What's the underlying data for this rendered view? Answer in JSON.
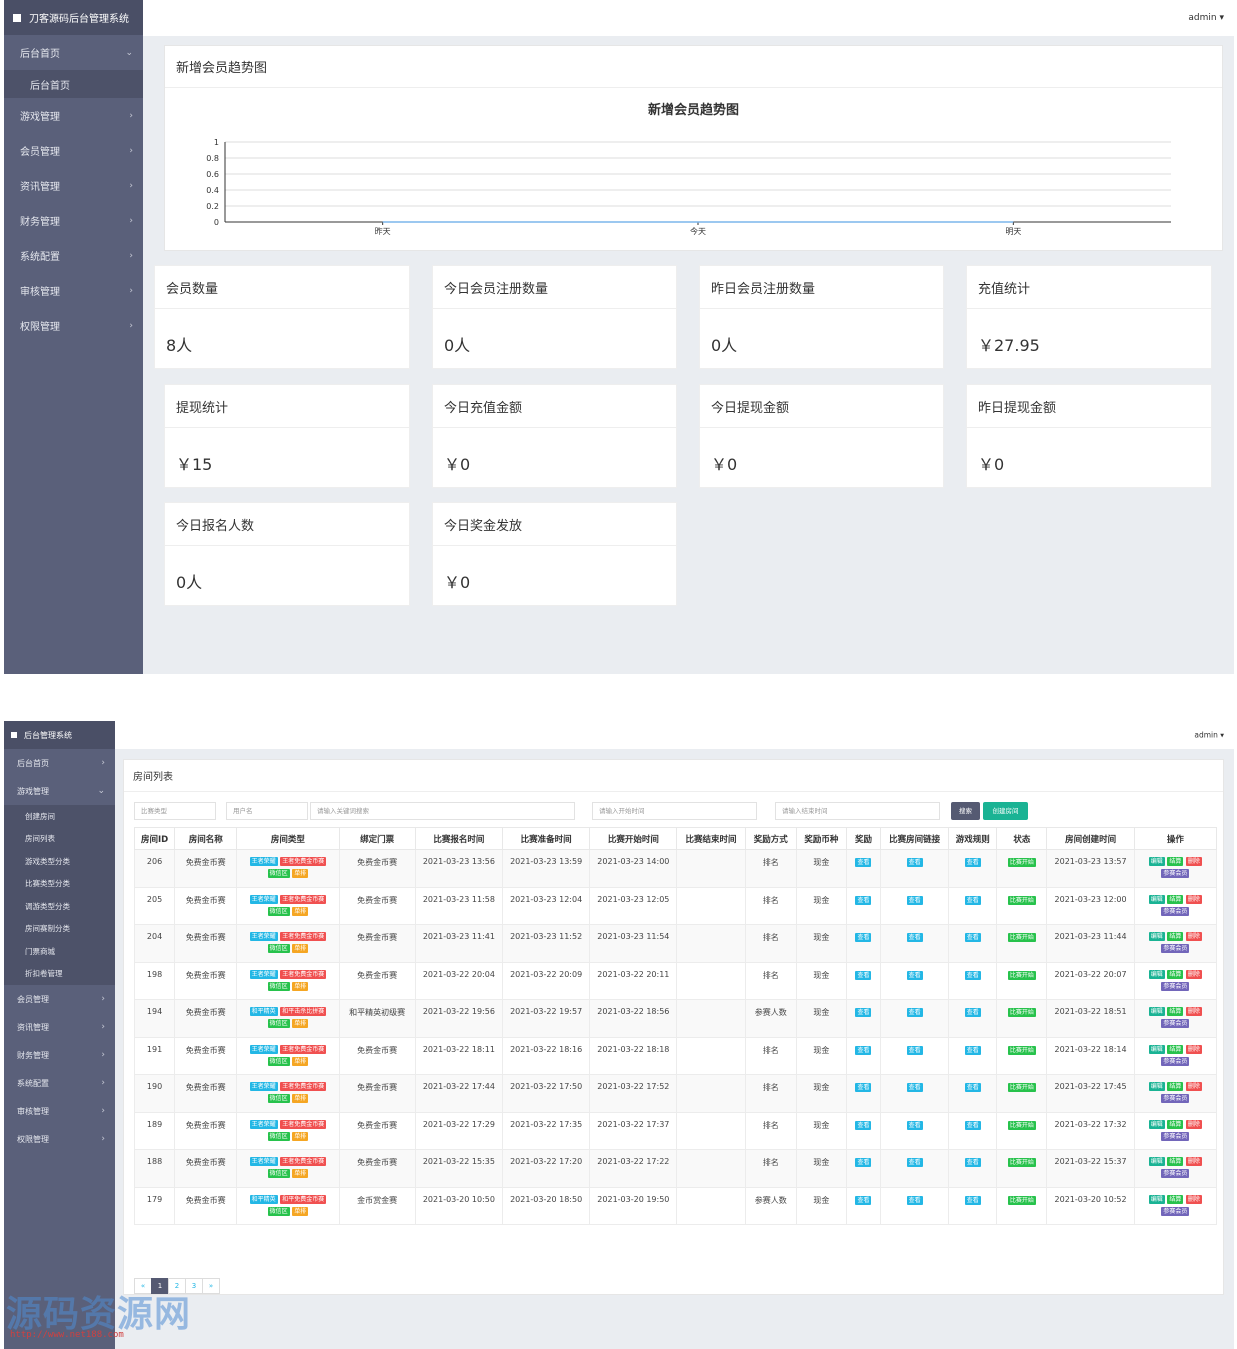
{
  "dashboard": {
    "brand": "刀客源码后台管理系统",
    "user": "admin",
    "nav": {
      "home": "后台首页",
      "home_sub": "后台首页",
      "items": [
        "游戏管理",
        "会员管理",
        "资讯管理",
        "财务管理",
        "系统配置",
        "审核管理",
        "权限管理"
      ]
    },
    "chart_panel_title": "新增会员趋势图",
    "chart_data": {
      "type": "line",
      "title": "新增会员趋势图",
      "categories": [
        "昨天",
        "今天",
        "明天"
      ],
      "series": [
        {
          "values": [
            0,
            0,
            0
          ]
        }
      ],
      "yticks": [
        "0",
        "0.2",
        "0.4",
        "0.6",
        "0.8",
        "1"
      ],
      "ylim": [
        0,
        1
      ],
      "grid": true
    },
    "stats": [
      {
        "label": "会员数量",
        "value": "8人"
      },
      {
        "label": "今日会员注册数量",
        "value": "0人"
      },
      {
        "label": "昨日会员注册数量",
        "value": "0人"
      },
      {
        "label": "充值统计",
        "value": "￥27.95"
      },
      {
        "label": "提现统计",
        "value": "￥15"
      },
      {
        "label": "今日充值金额",
        "value": "￥0"
      },
      {
        "label": "今日提现金额",
        "value": "￥0"
      },
      {
        "label": "昨日提现金额",
        "value": "￥0"
      },
      {
        "label": "今日报名人数",
        "value": "0人"
      },
      {
        "label": "今日奖金发放",
        "value": "￥0"
      }
    ]
  },
  "rooms_page": {
    "brand": "后台管理系统",
    "user": "admin",
    "nav": {
      "home": "后台首页",
      "game": "游戏管理",
      "game_sub": [
        "创建房间",
        "房间列表",
        "游戏类型分类",
        "比赛类型分类",
        "调游类型分类",
        "房间赛制分类",
        "门票商城",
        "折扣卷管理"
      ],
      "items": [
        "会员管理",
        "资讯管理",
        "财务管理",
        "系统配置",
        "审核管理",
        "权限管理"
      ]
    },
    "title": "房间列表",
    "filters": {
      "match_type": "比赛类型",
      "username": "用户名",
      "keyword": "请输入关键词搜索",
      "start_time": "请输入开始时间",
      "end_time": "请输入结束时间",
      "search": "搜索",
      "create": "创建房间"
    },
    "columns": [
      "房间ID",
      "房间名称",
      "房间类型",
      "绑定门票",
      "比赛报名时间",
      "比赛准备时间",
      "比赛开始时间",
      "比赛结束时间",
      "奖励方式",
      "奖励币种",
      "奖励",
      "比赛房间链接",
      "游戏规则",
      "状态",
      "房间创建时间",
      "操作"
    ],
    "view_label": "查看",
    "status_label": "比赛开始",
    "actions": {
      "edit": "编辑",
      "settle": "结算",
      "delete": "删除",
      "members": "参赛会员"
    },
    "rows": [
      {
        "id": "206",
        "name": "免费金币赛",
        "types": [
          "王者荣耀",
          "王者免费金币赛",
          "微信区",
          "单排"
        ],
        "ticket": "免费金币赛",
        "signup": "2021-03-23 13:56",
        "prepare": "2021-03-23 13:59",
        "start": "2021-03-23 14:00",
        "end": "",
        "reward_mode": "排名",
        "currency": "现金",
        "created": "2021-03-23 13:57"
      },
      {
        "id": "205",
        "name": "免费金币赛",
        "types": [
          "王者荣耀",
          "王者免费金币赛",
          "微信区",
          "单排"
        ],
        "ticket": "免费金币赛",
        "signup": "2021-03-23 11:58",
        "prepare": "2021-03-23 12:04",
        "start": "2021-03-23 12:05",
        "end": "",
        "reward_mode": "排名",
        "currency": "现金",
        "created": "2021-03-23 12:00"
      },
      {
        "id": "204",
        "name": "免费金币赛",
        "types": [
          "王者荣耀",
          "王者免费金币赛",
          "微信区",
          "单排"
        ],
        "ticket": "免费金币赛",
        "signup": "2021-03-23 11:41",
        "prepare": "2021-03-23 11:52",
        "start": "2021-03-23 11:54",
        "end": "",
        "reward_mode": "排名",
        "currency": "现金",
        "created": "2021-03-23 11:44"
      },
      {
        "id": "198",
        "name": "免费金币赛",
        "types": [
          "王者荣耀",
          "王者免费金币赛",
          "微信区",
          "单排"
        ],
        "ticket": "免费金币赛",
        "signup": "2021-03-22 20:04",
        "prepare": "2021-03-22 20:09",
        "start": "2021-03-22 20:11",
        "end": "",
        "reward_mode": "排名",
        "currency": "现金",
        "created": "2021-03-22 20:07"
      },
      {
        "id": "194",
        "name": "免费金币赛",
        "types": [
          "和平精英",
          "和平击杀比拼赛",
          "微信区",
          "单排"
        ],
        "ticket": "和平精英初级赛",
        "signup": "2021-03-22 19:56",
        "prepare": "2021-03-22 19:57",
        "start": "2021-03-22 18:56",
        "end": "",
        "reward_mode": "参赛人数",
        "currency": "现金",
        "created": "2021-03-22 18:51"
      },
      {
        "id": "191",
        "name": "免费金币赛",
        "types": [
          "王者荣耀",
          "王者免费金币赛",
          "微信区",
          "单排"
        ],
        "ticket": "免费金币赛",
        "signup": "2021-03-22 18:11",
        "prepare": "2021-03-22 18:16",
        "start": "2021-03-22 18:18",
        "end": "",
        "reward_mode": "排名",
        "currency": "现金",
        "created": "2021-03-22 18:14"
      },
      {
        "id": "190",
        "name": "免费金币赛",
        "types": [
          "王者荣耀",
          "王者免费金币赛",
          "微信区",
          "单排"
        ],
        "ticket": "免费金币赛",
        "signup": "2021-03-22 17:44",
        "prepare": "2021-03-22 17:50",
        "start": "2021-03-22 17:52",
        "end": "",
        "reward_mode": "排名",
        "currency": "现金",
        "created": "2021-03-22 17:45"
      },
      {
        "id": "189",
        "name": "免费金币赛",
        "types": [
          "王者荣耀",
          "王者免费金币赛",
          "微信区",
          "单排"
        ],
        "ticket": "免费金币赛",
        "signup": "2021-03-22 17:29",
        "prepare": "2021-03-22 17:35",
        "start": "2021-03-22 17:37",
        "end": "",
        "reward_mode": "排名",
        "currency": "现金",
        "created": "2021-03-22 17:32"
      },
      {
        "id": "188",
        "name": "免费金币赛",
        "types": [
          "王者荣耀",
          "王者免费金币赛",
          "微信区",
          "单排"
        ],
        "ticket": "免费金币赛",
        "signup": "2021-03-22 15:35",
        "prepare": "2021-03-22 17:20",
        "start": "2021-03-22 17:22",
        "end": "",
        "reward_mode": "排名",
        "currency": "现金",
        "created": "2021-03-22 15:37"
      },
      {
        "id": "179",
        "name": "免费金币赛",
        "types": [
          "和平精英",
          "和平免费金币赛",
          "微信区",
          "单排"
        ],
        "ticket": "金币赏金赛",
        "signup": "2021-03-20 10:50",
        "prepare": "2021-03-20 18:50",
        "start": "2021-03-20 19:50",
        "end": "",
        "reward_mode": "参赛人数",
        "currency": "现金",
        "created": "2021-03-20 10:52"
      }
    ],
    "pagination": [
      "«",
      "1",
      "2",
      "3",
      "»"
    ]
  },
  "watermark": {
    "text": "源码资源网",
    "url": "http://www.net188.com"
  },
  "colors": {
    "sidebar": "#5a607a",
    "cyan": "#23b7e5",
    "red": "#f05050",
    "green": "#27c24c",
    "orange": "#f5a623",
    "purple": "#7266ba",
    "teal": "#1ab394"
  }
}
